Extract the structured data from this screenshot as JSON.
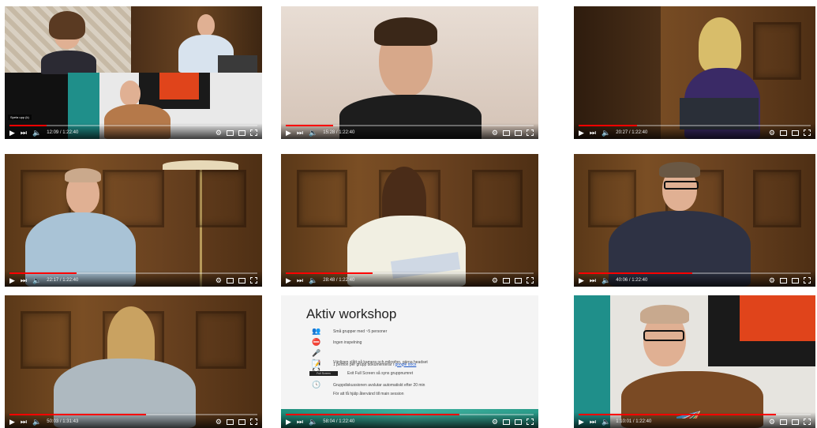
{
  "videos": [
    {
      "time": "12:09 / 1:22:40",
      "progress": 0.15,
      "badge": "Spela upp (k)"
    },
    {
      "time": "15:28 / 1:22:40",
      "progress": 0.19
    },
    {
      "time": "20:27 / 1:22:40",
      "progress": 0.25
    },
    {
      "time": "22:17 / 1:22:40",
      "progress": 0.27
    },
    {
      "time": "28:48 / 1:22:40",
      "progress": 0.35
    },
    {
      "time": "40:06 / 1:22:40",
      "progress": 0.49
    },
    {
      "time": "50:03 / 1:31:43",
      "progress": 0.55
    },
    {
      "time": "58:04 / 1:22:40",
      "progress": 0.7
    },
    {
      "time": "1:10:01 / 1:22:40",
      "progress": 0.85
    }
  ],
  "slide": {
    "title": "Aktiv workshop",
    "rows": [
      {
        "icon": "group-icon",
        "glyph": "👥",
        "text": "Små grupper med ~5 personer"
      },
      {
        "icon": "no-recording-icon",
        "glyph": "⛔",
        "text": "Ingen inspelning"
      },
      {
        "icon": "media-icons",
        "glyph": "🎤📷🎧",
        "text": "Vänligen slått på kamera och mikrofon, gärna headset"
      },
      {
        "icon": "document-icon",
        "glyph": "📝",
        "text_before": "1 person per grupp dokumenterar i ",
        "link": "google docs",
        "text_after": ""
      },
      {
        "icon": "fullscreen-button",
        "button": "Full Screen",
        "text": "Exit Full Screen så syns gruppnumret"
      },
      {
        "icon": "clock-icon",
        "glyph": "🕓",
        "text": "Gruppdiskussionen avslutar automatiskt efter 20 min"
      },
      {
        "icon": "",
        "glyph": "",
        "text": "För att få hjälp återvänd till main session"
      }
    ]
  },
  "colors": {
    "accent": "#ff0000",
    "slide_footer": "#2a9c8a"
  }
}
